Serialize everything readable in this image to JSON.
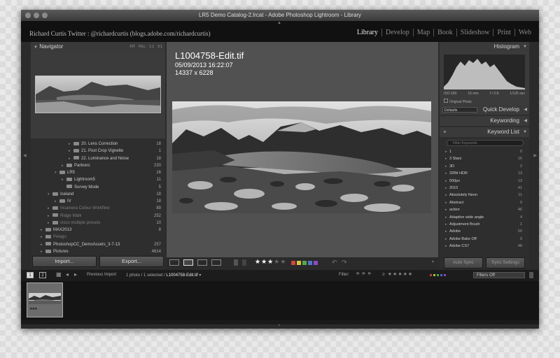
{
  "window": {
    "title": "LR5 Demo Catalog-2.lrcat - Adobe Photoshop Lightroom - Library"
  },
  "identity_plate": "Richard Curtis Twitter : @richardcurtis (blogs.adobe.com/richardcurtis)",
  "modules": [
    "Library",
    "Develop",
    "Map",
    "Book",
    "Slideshow",
    "Print",
    "Web"
  ],
  "active_module": "Library",
  "navigator": {
    "title": "Navigator",
    "options": [
      "FIT",
      "FILL",
      "1:1",
      "3:1"
    ]
  },
  "folders": [
    {
      "label": "20. Lens Correction",
      "count": "18",
      "indent": 5,
      "dim": false,
      "expander": "▸"
    },
    {
      "label": "21. Post Crop Vignette",
      "count": "1",
      "indent": 5,
      "dim": false,
      "expander": "▸"
    },
    {
      "label": "22. Luminance and Noise",
      "count": "18",
      "indent": 5,
      "dim": false,
      "expander": "▸"
    },
    {
      "label": "Partners",
      "count": "230",
      "indent": 4,
      "dim": false,
      "expander": "▸"
    },
    {
      "label": "LR5",
      "count": "16",
      "indent": 3,
      "dim": false,
      "expander": "▾"
    },
    {
      "label": "Lightroom5",
      "count": "11",
      "indent": 4,
      "dim": false,
      "expander": "▸"
    },
    {
      "label": "Survey Mode",
      "count": "5",
      "indent": 4,
      "dim": false,
      "expander": ""
    },
    {
      "label": "Iceland",
      "count": "18",
      "indent": 2,
      "dim": false,
      "expander": "▾"
    },
    {
      "label": "IV",
      "count": "18",
      "indent": 3,
      "dim": false,
      "expander": "▸"
    },
    {
      "label": "Incamera Colour Workflow",
      "count": "89",
      "indent": 2,
      "dim": true,
      "expander": "▸"
    },
    {
      "label": "Ridge Walk",
      "count": "252",
      "indent": 2,
      "dim": true,
      "expander": "▸"
    },
    {
      "label": "visco multiple presets",
      "count": "10",
      "indent": 2,
      "dim": true,
      "expander": "▸"
    },
    {
      "label": "MAX2013",
      "count": "8",
      "indent": 1,
      "dim": false,
      "expander": "▸"
    },
    {
      "label": "Pelago",
      "count": "",
      "indent": 1,
      "dim": true,
      "expander": "▸"
    },
    {
      "label": "PhotoshopCC_DemoAssets_3-7-13",
      "count": "257",
      "indent": 1,
      "dim": false,
      "expander": "▸"
    },
    {
      "label": "Pictures",
      "count": "4614",
      "indent": 1,
      "dim": false,
      "expander": "▸"
    }
  ],
  "buttons": {
    "import": "Import...",
    "export": "Export...",
    "auto_sync": "Auto Sync",
    "sync_settings": "Sync Settings"
  },
  "photo": {
    "filename": "L1004758-Edit.tif",
    "datetime": "05/09/2013 16:22:07",
    "dimensions": "14337 x 6228"
  },
  "toolbar": {
    "rating_stars": 3,
    "max_stars": 5,
    "color_labels": [
      "#d14545",
      "#d8c440",
      "#5aa64a",
      "#4a78c8",
      "#8a4ac0"
    ]
  },
  "right_panel": {
    "histogram": "Histogram",
    "iso": "ISO 200",
    "focal": "15 mm",
    "aperture": "f / 2.8",
    "shutter": "1/125 sec",
    "original_photo": "Original Photo",
    "quick_develop": "Quick Develop",
    "preset": "Defaults",
    "keywording": "Keywording",
    "keyword_list": "Keyword List",
    "filter_placeholder": "Filter Keywords",
    "keywords": [
      {
        "name": "1",
        "count": "0"
      },
      {
        "name": "3 Stars",
        "count": "16"
      },
      {
        "name": "3D",
        "count": "2"
      },
      {
        "name": "32Bit HDR",
        "count": "13"
      },
      {
        "name": "500px",
        "count": "13"
      },
      {
        "name": "2010",
        "count": "41"
      },
      {
        "name": "Absolutely Neon",
        "count": "11"
      },
      {
        "name": "Abstract",
        "count": "0"
      },
      {
        "name": "action",
        "count": "46"
      },
      {
        "name": "Adaptive wide angle",
        "count": "4"
      },
      {
        "name": "Adjustment Brush",
        "count": "1"
      },
      {
        "name": "Adobe",
        "count": "50"
      },
      {
        "name": "Adobe Bake Off",
        "count": "0"
      },
      {
        "name": "Adobe CS7",
        "count": "48"
      }
    ]
  },
  "filmstrip": {
    "pages": [
      "1",
      "2"
    ],
    "source": "Previous Import",
    "selection_prefix": "1 photo / 1 selected / ",
    "selected_file": "L1004758-Edit.tif",
    "filter_label": "Filter:",
    "filter_value": "Filters Off",
    "thumb_stars": 3
  }
}
